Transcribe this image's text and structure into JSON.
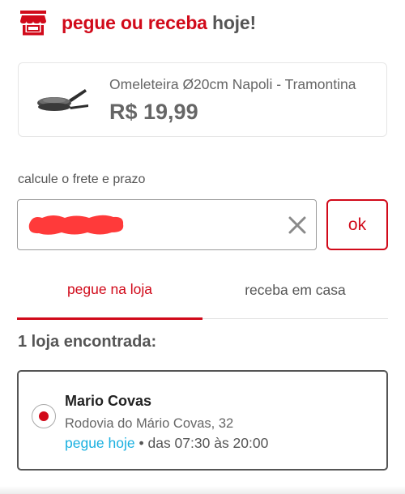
{
  "header": {
    "title_accent": "pegue ou receba",
    "title_rest": "hoje!",
    "icon": "store-icon"
  },
  "product": {
    "name": "Omeleteira Ø20cm Napoli - Tramontina",
    "price": "R$ 19,99",
    "image": "frying-pan-image"
  },
  "shipping": {
    "label": "calcule o frete e prazo",
    "cep_value": "",
    "ok_label": "ok",
    "clear_icon": "close-icon"
  },
  "tabs": [
    {
      "label": "pegue na loja",
      "active": true
    },
    {
      "label": "receba em casa",
      "active": false
    }
  ],
  "results": {
    "title": "1 loja encontrada:",
    "stores": [
      {
        "name": "Mario Covas",
        "address": "Rodovia do Mário Covas, 32",
        "pickup": "pegue hoje",
        "hours": " • das 07:30 às 20:00",
        "selected": true
      }
    ]
  },
  "colors": {
    "accent": "#d10a1a",
    "pickup_blue": "#1ab0e0",
    "text": "#555555"
  }
}
